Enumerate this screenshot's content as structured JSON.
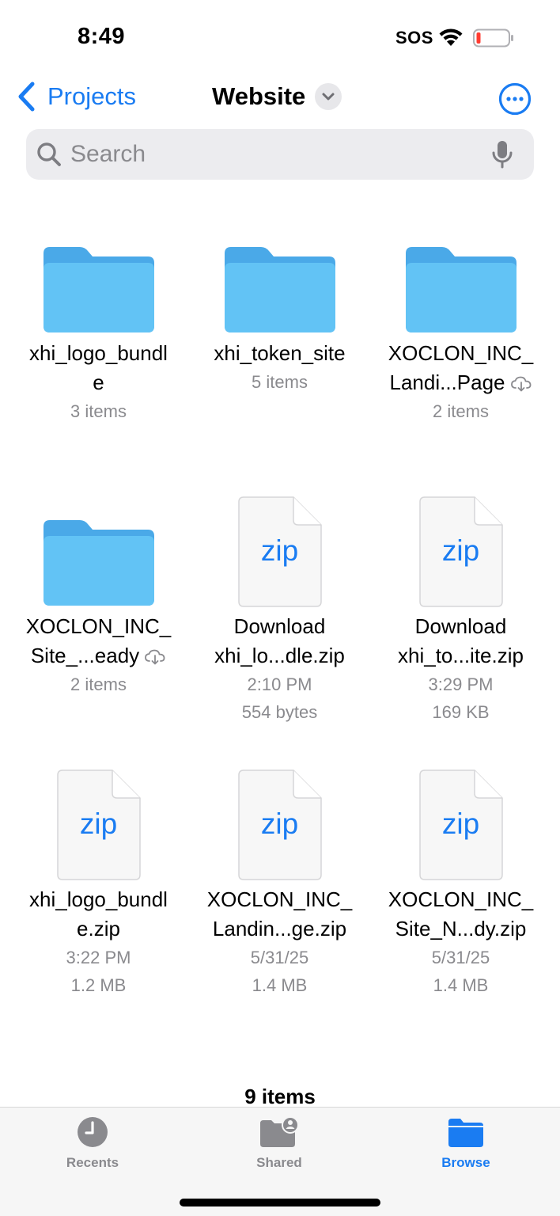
{
  "status": {
    "time": "8:49",
    "sos": "SOS"
  },
  "nav": {
    "back_label": "Projects",
    "title": "Website"
  },
  "search": {
    "placeholder": "Search"
  },
  "colors": {
    "accent": "#1a7cf2",
    "folder": "#5bc0f2",
    "battery_low": "#ff3b30"
  },
  "items": [
    {
      "type": "folder",
      "name": "xhi_logo_bundle",
      "line1": "xhi_logo_bundl",
      "line2": "e",
      "meta1": "3 items",
      "meta2": "",
      "cloud": false
    },
    {
      "type": "folder",
      "name": "xhi_token_site",
      "line1": "xhi_token_site",
      "line2": "",
      "meta1": "5 items",
      "meta2": "",
      "cloud": false
    },
    {
      "type": "folder",
      "name": "XOCLON_INC_Landing_Page",
      "line1": "XOCLON_INC_",
      "line2": "Landi...Page",
      "meta1": "2 items",
      "meta2": "",
      "cloud": true
    },
    {
      "type": "folder",
      "name": "XOCLON_INC_Site_Ready",
      "line1": "XOCLON_INC_",
      "line2": "Site_...eady",
      "meta1": "2 items",
      "meta2": "",
      "cloud": true
    },
    {
      "type": "zip",
      "name": "Download xhi_logo_bundle.zip",
      "line1": "Download",
      "line2": "xhi_lo...dle.zip",
      "meta1": "2:10 PM",
      "meta2": "554 bytes",
      "cloud": false
    },
    {
      "type": "zip",
      "name": "Download xhi_token_site.zip",
      "line1": "Download",
      "line2": "xhi_to...ite.zip",
      "meta1": "3:29 PM",
      "meta2": "169 KB",
      "cloud": false
    },
    {
      "type": "zip",
      "name": "xhi_logo_bundle.zip",
      "line1": "xhi_logo_bundl",
      "line2": "e.zip",
      "meta1": "3:22 PM",
      "meta2": "1.2 MB",
      "cloud": false
    },
    {
      "type": "zip",
      "name": "XOCLON_INC_Landing_Page.zip",
      "line1": "XOCLON_INC_",
      "line2": "Landin...ge.zip",
      "meta1": "5/31/25",
      "meta2": "1.4 MB",
      "cloud": false
    },
    {
      "type": "zip",
      "name": "XOCLON_INC_Site_Ready.zip",
      "line1": "XOCLON_INC_",
      "line2": "Site_N...dy.zip",
      "meta1": "5/31/25",
      "meta2": "1.4 MB",
      "cloud": false
    }
  ],
  "zip_label": "zip",
  "footer": {
    "count": "9 items"
  },
  "tabs": [
    {
      "label": "Recents",
      "icon": "clock-icon",
      "active": false
    },
    {
      "label": "Shared",
      "icon": "shared-folder-icon",
      "active": false
    },
    {
      "label": "Browse",
      "icon": "folder-icon",
      "active": true
    }
  ]
}
